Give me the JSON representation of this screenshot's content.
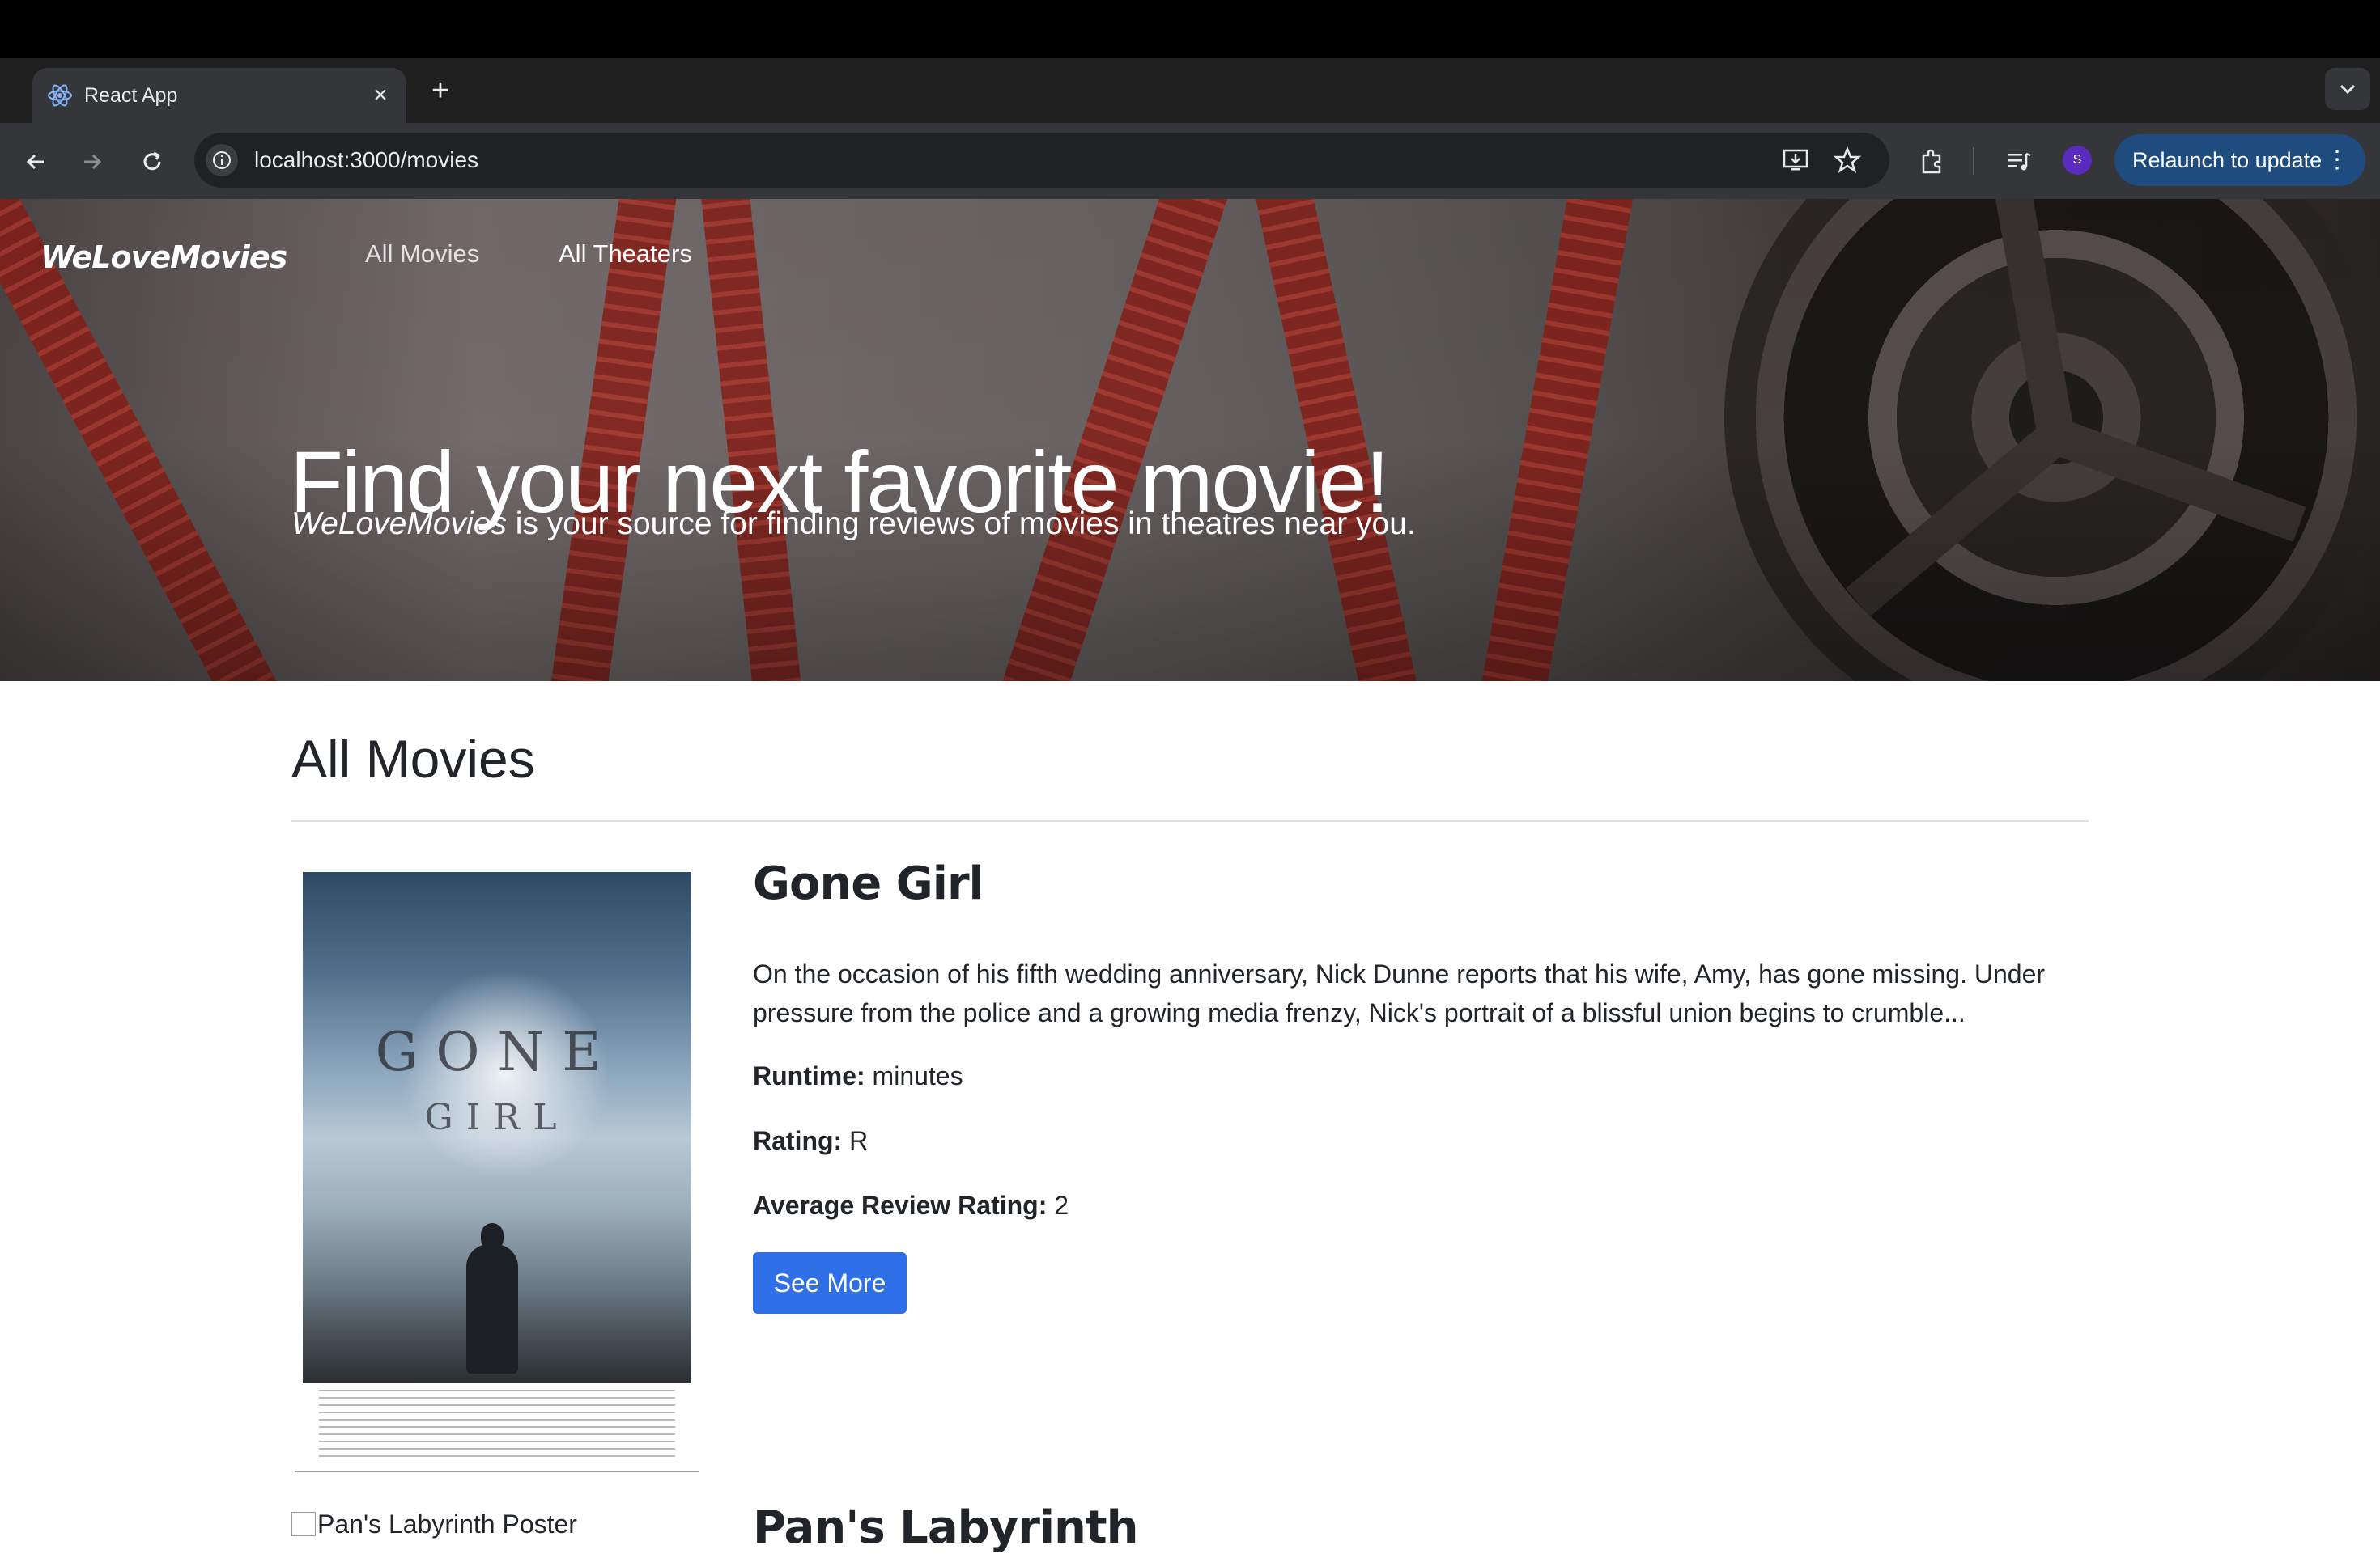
{
  "browser": {
    "tab_title": "React App",
    "tab_close": "×",
    "new_tab": "+",
    "url": "localhost:3000/movies",
    "profile_initial": "S",
    "relaunch_label": "Relaunch to update",
    "relaunch_menu": "⋮"
  },
  "nav": {
    "brand": "WeLoveMovies",
    "links": [
      "All Movies",
      "All Theaters"
    ]
  },
  "hero": {
    "title": "Find your next favorite movie!",
    "subtitle_brand": "WeLoveMovies",
    "subtitle_rest": " is your source for finding reviews of movies in theatres near you."
  },
  "section": {
    "title": "All Movies"
  },
  "movies": [
    {
      "title": "Gone Girl",
      "poster_text_line1": "GONE",
      "poster_text_line2": "GIRL",
      "description": "On the occasion of his fifth wedding anniversary, Nick Dunne reports that his wife, Amy, has gone missing. Under pressure from the police and a growing media frenzy, Nick's portrait of a blissful union begins to crumble...",
      "runtime_label": "Runtime:",
      "runtime_value": " minutes",
      "rating_label": "Rating:",
      "rating_value": " R",
      "avg_label": "Average Review Rating:",
      "avg_value": " 2",
      "button_label": "See More"
    },
    {
      "title": "Pan's Labyrinth",
      "poster_alt": "Pan's Labyrinth Poster"
    }
  ]
}
